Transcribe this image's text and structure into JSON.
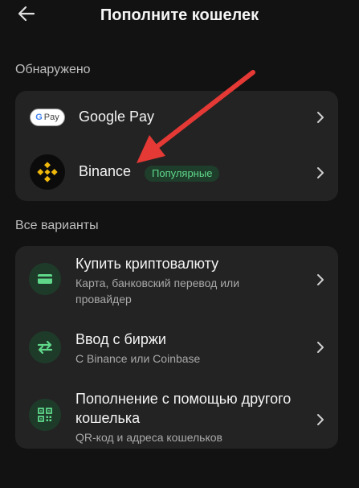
{
  "header": {
    "title": "Пополните кошелек"
  },
  "detected": {
    "label": "Обнаружено",
    "items": [
      {
        "label": "Google Pay",
        "icon": "google-pay-logo",
        "badge_text": "G Pay"
      },
      {
        "label": "Binance",
        "icon": "binance-logo",
        "badge": "Популярные"
      }
    ]
  },
  "all_options": {
    "label": "Все варианты",
    "items": [
      {
        "title": "Купить криптовалюту",
        "subtitle": "Карта, банковский перевод или провайдер",
        "icon": "card-icon"
      },
      {
        "title": "Ввод с биржи",
        "subtitle": "С Binance или Coinbase",
        "icon": "exchange-arrows-icon"
      },
      {
        "title": "Пополнение с помощью другого кошелька",
        "subtitle": "QR-код и адреса кошельков",
        "icon": "qr-code-icon"
      }
    ]
  },
  "colors": {
    "background": "#121212",
    "card": "#232323",
    "accent_green": "#5fd88a",
    "annotation_arrow": "#e53935"
  }
}
